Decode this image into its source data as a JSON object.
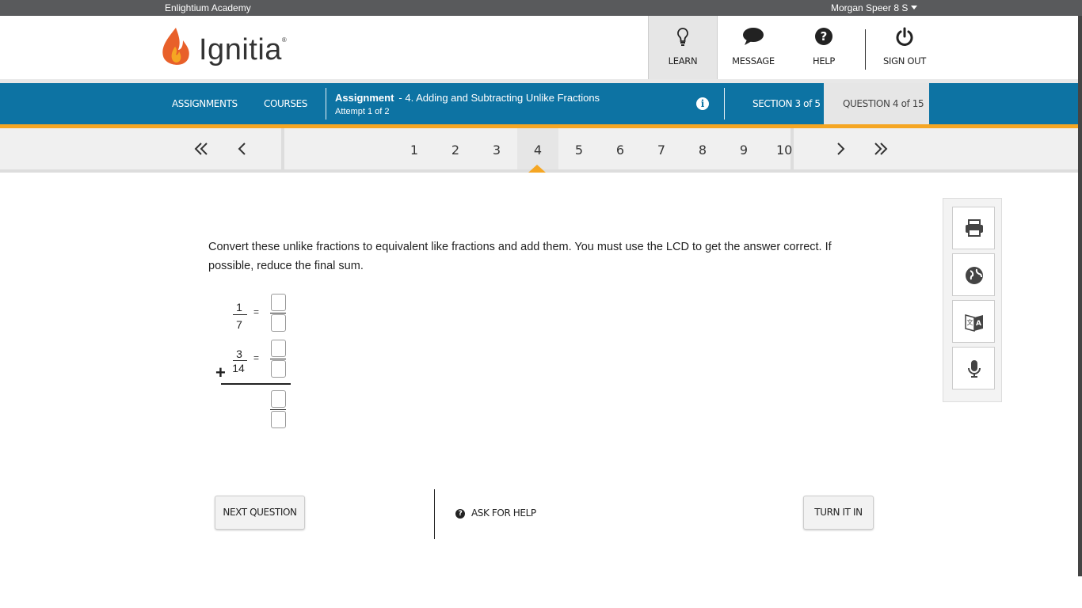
{
  "topbar": {
    "org": "Enlightium Academy",
    "user": "Morgan Speer 8 S"
  },
  "brand": {
    "name": "Ignitia",
    "mark": "®"
  },
  "nav": {
    "learn": "LEARN",
    "message": "MESSAGE",
    "help": "HELP",
    "signout": "SIGN OUT"
  },
  "bluebar": {
    "assignments": "ASSIGNMENTS",
    "courses": "COURSES",
    "assignment_label": "Assignment",
    "assignment_title": "- 4. Adding and Subtracting Unlike Fractions",
    "attempt": "Attempt 1 of 2",
    "section": "SECTION 3 of 5",
    "question": "QUESTION 4 of 15"
  },
  "pager": {
    "pages": [
      "1",
      "2",
      "3",
      "4",
      "5",
      "6",
      "7",
      "8",
      "9",
      "10"
    ],
    "active": "4"
  },
  "question": {
    "prompt": "Convert these unlike fractions to equivalent like fractions and add them. You must use the LCD to get the answer correct. If possible, reduce the final sum.",
    "frac1": {
      "num": "1",
      "den": "7"
    },
    "frac2": {
      "num": "3",
      "den": "14"
    },
    "equals": "=",
    "operator": "+"
  },
  "tools": [
    "printer-icon",
    "globe-icon",
    "translate-icon",
    "microphone-icon"
  ],
  "actions": {
    "next": "NEXT QUESTION",
    "ask": "ASK FOR HELP",
    "turnin": "TURN IT IN"
  },
  "colors": {
    "blue": "#0d73a3",
    "orange": "#f5a623",
    "topbar": "#595a5c"
  }
}
